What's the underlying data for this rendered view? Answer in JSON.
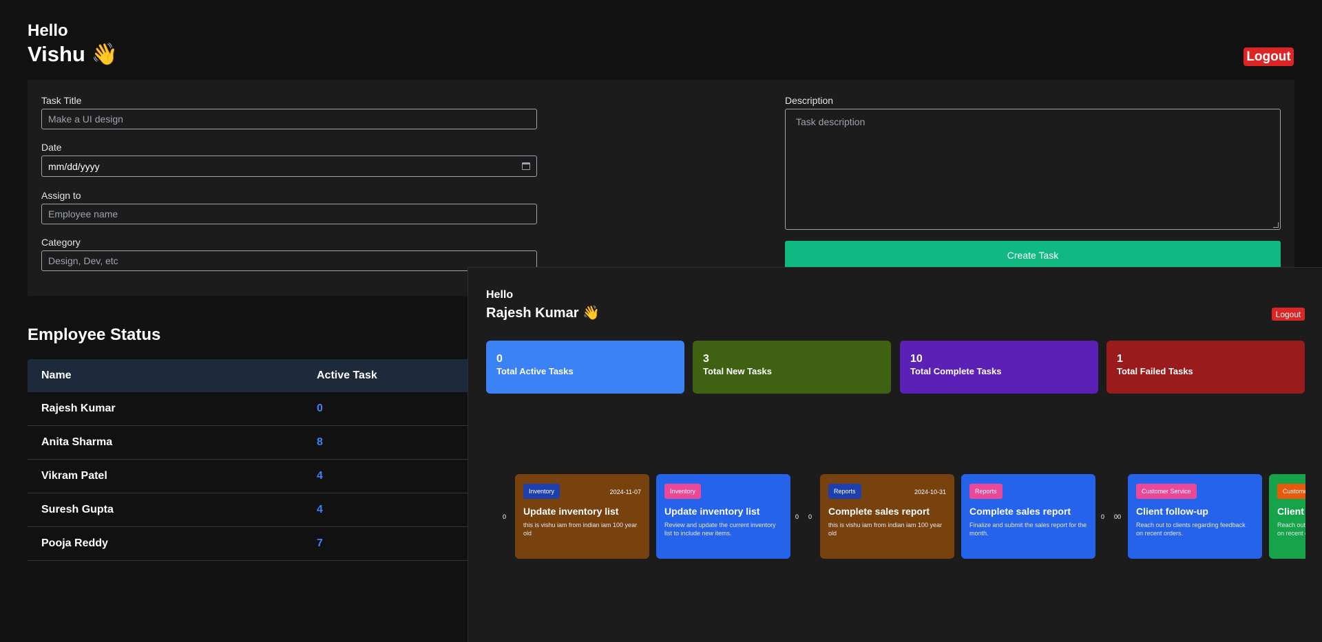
{
  "admin": {
    "hello": "Hello",
    "name": "Vishu",
    "wave": "👋",
    "logout_label": "Logout"
  },
  "form": {
    "task_title_label": "Task Title",
    "task_title_placeholder": "Make a UI design",
    "date_label": "Date",
    "date_value": "mm/dd/yyyy",
    "assign_label": "Assign to",
    "assign_placeholder": "Employee name",
    "category_label": "Category",
    "category_placeholder": "Design, Dev, etc",
    "description_label": "Description",
    "description_placeholder": "Task description",
    "create_label": "Create Task"
  },
  "employee_status": {
    "title": "Employee Status",
    "columns": [
      "Name",
      "Active Task"
    ],
    "rows": [
      {
        "name": "Rajesh Kumar",
        "active": "0"
      },
      {
        "name": "Anita Sharma",
        "active": "8"
      },
      {
        "name": "Vikram Patel",
        "active": "4"
      },
      {
        "name": "Suresh Gupta",
        "active": "4"
      },
      {
        "name": "Pooja Reddy",
        "active": "7"
      }
    ]
  },
  "employee_dashboard": {
    "hello": "Hello",
    "name": "Rajesh Kumar",
    "wave": "👋",
    "logout_label": "Logout",
    "stats": [
      {
        "value": "0",
        "label": "Total Active Tasks",
        "color": "#3b82f6"
      },
      {
        "value": "3",
        "label": "Total New Tasks",
        "color": "#3f6212"
      },
      {
        "value": "10",
        "label": "Total Complete Tasks",
        "color": "#5b21b6"
      },
      {
        "value": "1",
        "label": "Total Failed Tasks",
        "color": "#991b1b"
      }
    ],
    "stray_text": [
      "0",
      "0",
      "0",
      "0",
      "00"
    ],
    "tasks": [
      {
        "category": "Inventory",
        "date": "2024-11-07",
        "title": "Update inventory list",
        "description": "this is vishu iam from indian iam 100 year old",
        "card_color": "#78420f",
        "tag_color": "#1e40af"
      },
      {
        "category": "Inventory",
        "date": "",
        "title": "Update inventory list",
        "description": "Review and update the current inventory list to include new items.",
        "card_color": "#2563eb",
        "tag_color": "#ec4899"
      },
      {
        "category": "Reports",
        "date": "2024-10-31",
        "title": "Complete sales report",
        "description": "this is vishu iam from indian iam 100 year old",
        "card_color": "#78420f",
        "tag_color": "#1e40af"
      },
      {
        "category": "Reports",
        "date": "",
        "title": "Complete sales report",
        "description": "Finalize and submit the sales report for the month.",
        "card_color": "#2563eb",
        "tag_color": "#ec4899"
      },
      {
        "category": "Customer Service",
        "date": "",
        "title": "Client follow-up",
        "description": "Reach out to clients regarding feedback on recent orders.",
        "card_color": "#2563eb",
        "tag_color": "#ec4899"
      },
      {
        "category": "Customer Service",
        "date": "",
        "title": "Client follow-up",
        "description": "Reach out to clients regarding feedback on recent orders.",
        "card_color": "#16a34a",
        "tag_color": "#ea580c"
      }
    ]
  }
}
